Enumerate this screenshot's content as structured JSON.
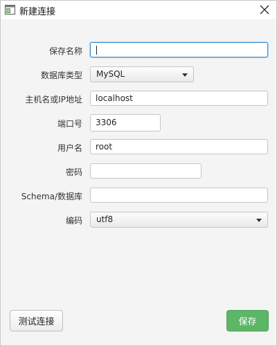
{
  "window": {
    "title": "新建连接"
  },
  "form": {
    "name": {
      "label": "保存名称",
      "value": ""
    },
    "db_type": {
      "label": "数据库类型",
      "value": "MySQL"
    },
    "host": {
      "label": "主机名或IP地址",
      "value": "localhost"
    },
    "port": {
      "label": "端口号",
      "value": "3306"
    },
    "username": {
      "label": "用户名",
      "value": "root"
    },
    "password": {
      "label": "密码",
      "value": ""
    },
    "schema": {
      "label": "Schema/数据库",
      "value": ""
    },
    "encoding": {
      "label": "编码",
      "value": "utf8"
    }
  },
  "buttons": {
    "test_label": "测试连接",
    "save_label": "保存"
  },
  "colors": {
    "save_button": "#5cb668",
    "focus_border": "#3f8fd6"
  }
}
